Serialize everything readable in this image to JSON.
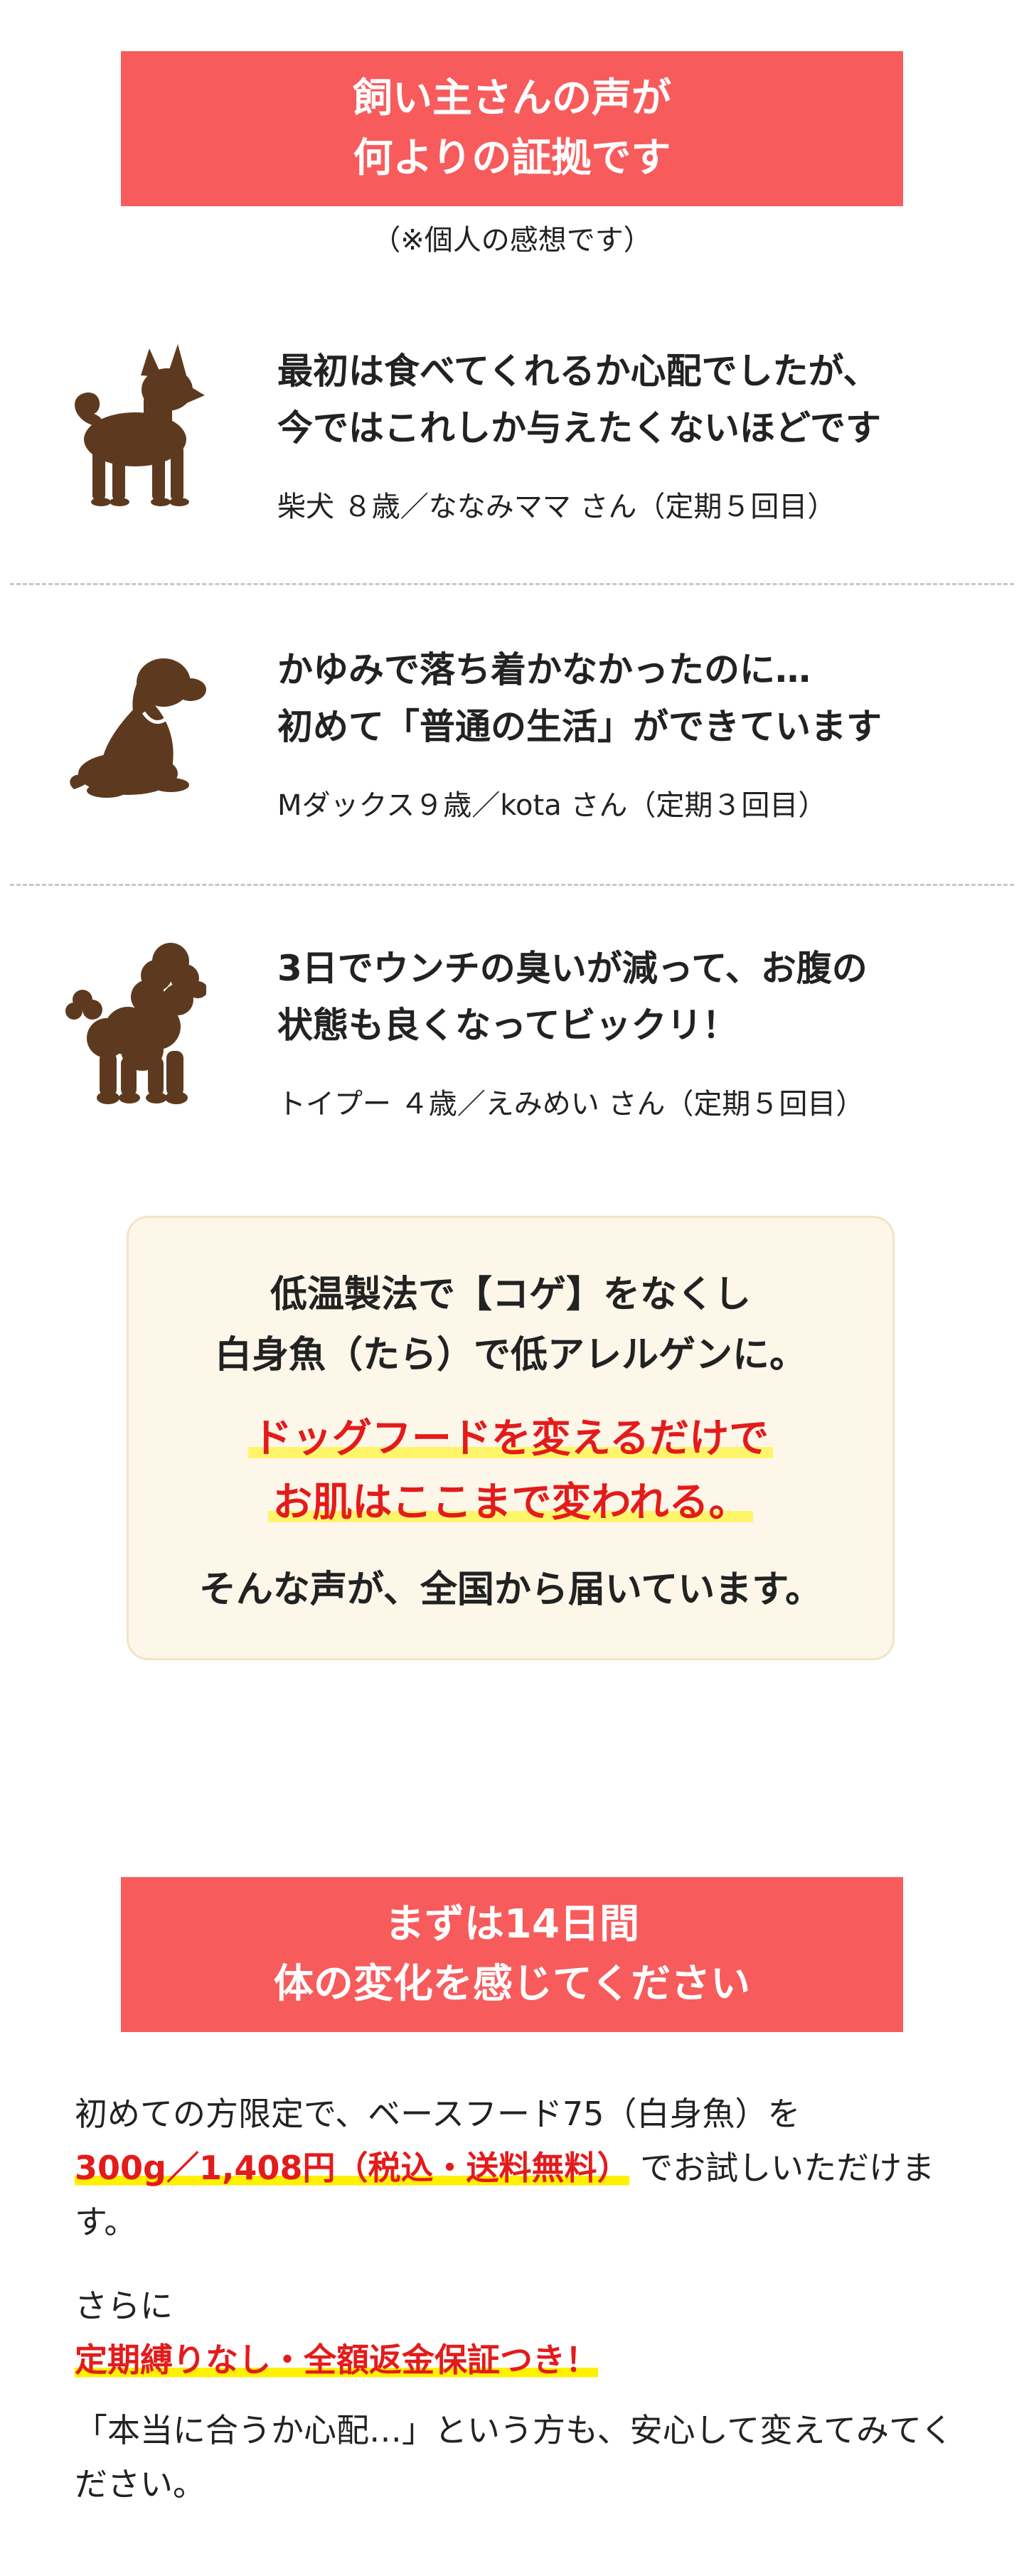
{
  "header_banner": {
    "line1": "飼い主さんの声が",
    "line2": "何よりの証拠です"
  },
  "note": "（※個人の感想です）",
  "testimonials": [
    {
      "dog_icon": "shiba-dog-icon",
      "quote_line1": "最初は食べてくれるか心配でしたが、",
      "quote_line2": "今ではこれしか与えたくないほどです",
      "author": "柴犬 ８歳／ななみママ さん（定期５回目）"
    },
    {
      "dog_icon": "dachshund-dog-icon",
      "quote_line1": "かゆみで落ち着かなかったのに…",
      "quote_line2": "初めて「普通の生活」ができています",
      "author": "Mダックス９歳／kota さん（定期３回目）"
    },
    {
      "dog_icon": "poodle-dog-icon",
      "quote_line1": "3日でウンチの臭いが減って、お腹の",
      "quote_line2": "状態も良くなってビックリ！",
      "author": "トイプー ４歳／えみめい さん（定期５回目）"
    }
  ],
  "highlight_card": {
    "line1": "低温製法で【コゲ】をなくし",
    "line2": "白身魚（たら）で低アレルゲンに。",
    "line3": "ドッグフードを変えるだけで",
    "line4": "お肌はここまで変われる。",
    "line5": "そんな声が、全国から届いています。"
  },
  "trial_banner": {
    "line1": "まずは14日間",
    "line2": "体の変化を感じてください"
  },
  "trial": {
    "p1_prefix": "初めての方限定で、ベースフード75（白身魚）を",
    "p1_price": "300g／1,408円（税込・送料無料）",
    "p1_suffix": " でお試しいただけます。",
    "p2_prefix": "さらに",
    "p2_guarantee": "定期縛りなし・全額返金保証つき！",
    "p3": "「本当に合うか心配…」という方も、安心して変えてみてください。"
  },
  "colors": {
    "banner": "#f85b5c",
    "accent_red": "#e41b1b",
    "highlight_yellow": "#fff100",
    "dog_brown": "#5d3a1f",
    "card_bg": "#fdf7ea"
  }
}
